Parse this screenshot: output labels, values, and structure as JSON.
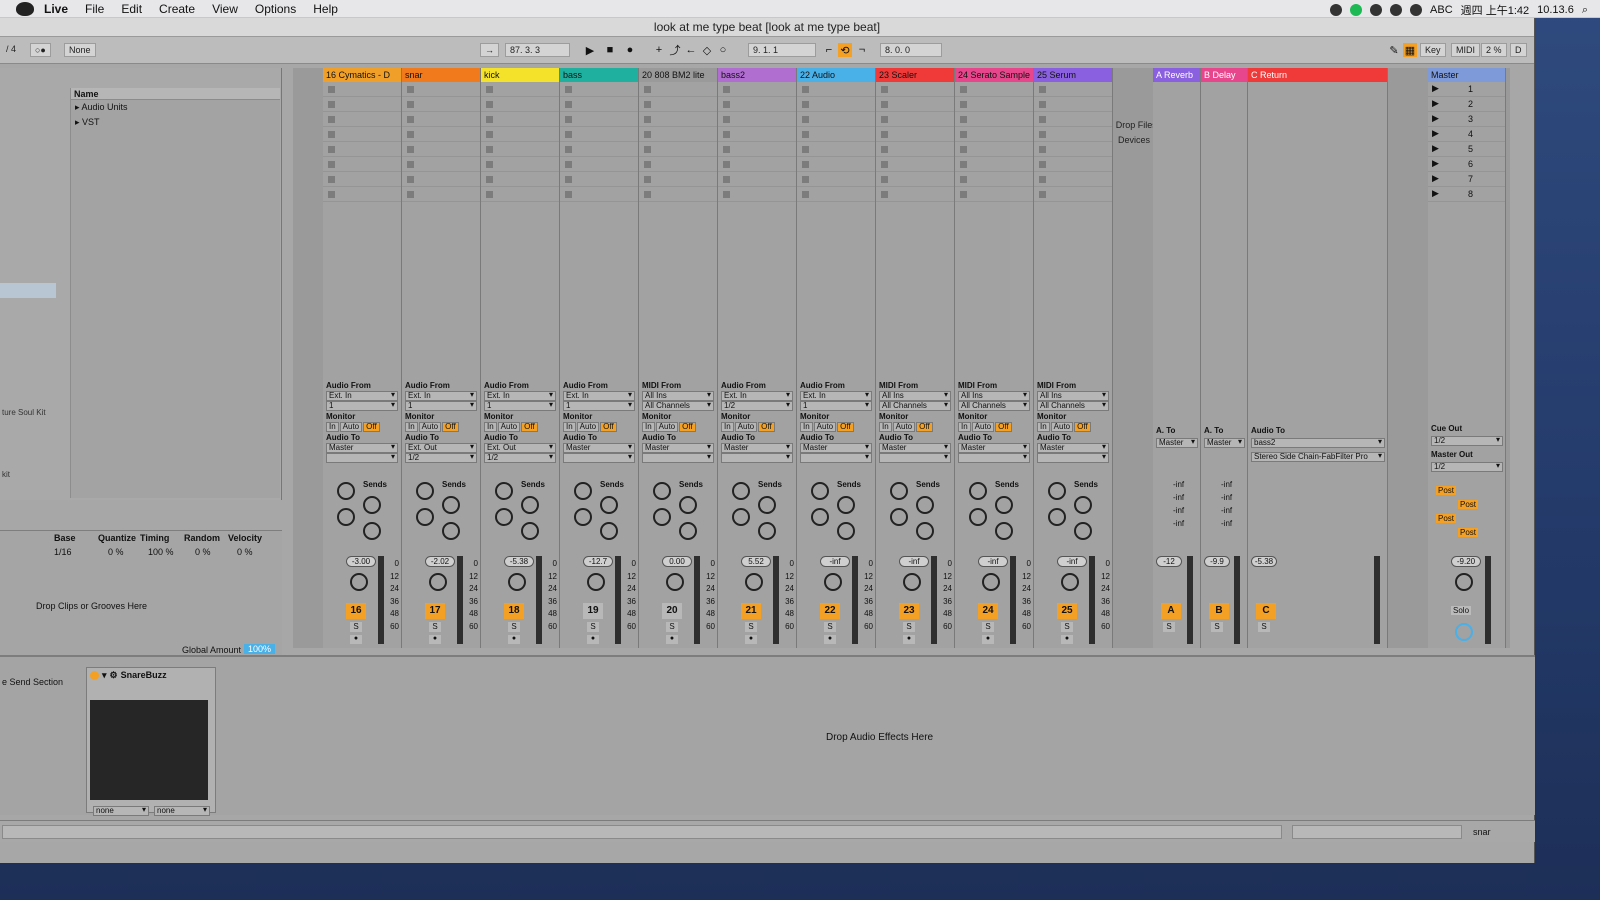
{
  "menubar": {
    "app": "Live",
    "items": [
      "File",
      "Edit",
      "Create",
      "View",
      "Options",
      "Help"
    ],
    "right": {
      "input": "ABC",
      "datetime": "週四 上午1:42",
      "version": "10.13.6"
    }
  },
  "window": {
    "title": "look at me type beat  [look at me type beat]"
  },
  "transport": {
    "meter": "/ 4",
    "quantize": "None",
    "tempo_pos": "87.  3.  3",
    "loop_start": "9.  1.  1",
    "loop_len": "8.  0.  0",
    "key": "Key",
    "midi": "MIDI",
    "cpu": "2 %",
    "d": "D"
  },
  "browser": {
    "name_header": "Name",
    "items": [
      "Audio Units",
      "VST"
    ],
    "left_labels": [
      "ture Soul Kit",
      "kit"
    ]
  },
  "groove": {
    "headers": [
      "Base",
      "Quantize",
      "Timing",
      "Random",
      "Velocity"
    ],
    "values": [
      "1/16",
      "0 %",
      "100 %",
      "0 %",
      "0 %"
    ],
    "drop_text": "Drop Clips or Grooves Here",
    "global_label": "Global Amount",
    "global_value": "100%"
  },
  "tracks": [
    {
      "name": "16 Cymatics - D",
      "color": "#f0a028",
      "type": "Audio From",
      "src": "Ext. In",
      "ch": "1",
      "to": "Master",
      "vol": "-3.00",
      "num": "16",
      "on": true
    },
    {
      "name": "snar",
      "color": "#f07a1c",
      "type": "Audio From",
      "src": "Ext. In",
      "ch": "1",
      "to": "Ext. Out",
      "ch2": "1/2",
      "vol": "-2.02",
      "num": "17",
      "on": true
    },
    {
      "name": "kick",
      "color": "#f4e12a",
      "type": "Audio From",
      "src": "Ext. In",
      "ch": "1",
      "to": "Ext. Out",
      "ch2": "1/2",
      "vol": "-5.38",
      "num": "18",
      "on": true
    },
    {
      "name": "bass",
      "color": "#20b0a0",
      "type": "Audio From",
      "src": "Ext. In",
      "ch": "1",
      "to": "Master",
      "vol": "-12.7",
      "num": "19",
      "on": false
    },
    {
      "name": "20 808 BM2 lite",
      "color": "#9a9a9a",
      "type": "MIDI From",
      "src": "All Ins",
      "ch": "All Channels",
      "to": "Master",
      "vol": "0.00",
      "num": "20",
      "on": false
    },
    {
      "name": "bass2",
      "color": "#b06ed0",
      "type": "Audio From",
      "src": "Ext. In",
      "ch": "1/2",
      "to": "Master",
      "vol": "5.52",
      "num": "21",
      "on": true
    },
    {
      "name": "22 Audio",
      "color": "#4ab0e8",
      "type": "Audio From",
      "src": "Ext. In",
      "ch": "1",
      "to": "Master",
      "vol": "-inf",
      "num": "22",
      "on": true
    },
    {
      "name": "23 Scaler",
      "color": "#f03a3a",
      "type": "MIDI From",
      "src": "All Ins",
      "ch": "All Channels",
      "to": "Master",
      "vol": "-inf",
      "num": "23",
      "on": true
    },
    {
      "name": "24 Serato Sample",
      "color": "#e8468c",
      "type": "MIDI From",
      "src": "All Ins",
      "ch": "All Channels",
      "to": "Master",
      "vol": "-inf",
      "num": "24",
      "on": true
    },
    {
      "name": "25 Serum",
      "color": "#8a60e0",
      "type": "MIDI From",
      "src": "All Ins",
      "ch": "All Channels",
      "to": "Master",
      "vol": "-inf",
      "num": "25",
      "on": true
    }
  ],
  "returns": [
    {
      "name": "A Reverb",
      "color": "#8a60e0",
      "vol": "-12",
      "letter": "A"
    },
    {
      "name": "B Delay",
      "color": "#e8468c",
      "vol": "-9.9",
      "letter": "B"
    },
    {
      "name": "C Return",
      "color": "#f03a3a",
      "vol": "-5.38",
      "letter": "C",
      "to": "bass2",
      "fx": "Stereo Side Chain-FabFilter Pro"
    }
  ],
  "master": {
    "name": "Master",
    "scenes": [
      "1",
      "2",
      "3",
      "4",
      "5",
      "6",
      "7",
      "8"
    ],
    "cue_out": "Cue Out",
    "cue_val": "1/2",
    "master_out": "Master Out",
    "master_val": "1/2",
    "vol": "-9.20",
    "solo": "Solo"
  },
  "io_labels": {
    "monitor": "Monitor",
    "in": "In",
    "auto": "Auto",
    "off": "Off",
    "audio_to": "Audio To",
    "sends": "Sends",
    "a_to": "A. To",
    "post": "Post",
    "s": "S",
    "inf": "-inf"
  },
  "drop_files": "Drop Files and Devices Here",
  "device": {
    "name": "SnareBuzz",
    "sel1": "none",
    "sel2": "none",
    "drop": "Drop Audio Effects Here",
    "left_label": "e Send Section"
  },
  "status": {
    "selected": "snar"
  },
  "scale": [
    "0",
    "12",
    "24",
    "36",
    "48",
    "60"
  ]
}
